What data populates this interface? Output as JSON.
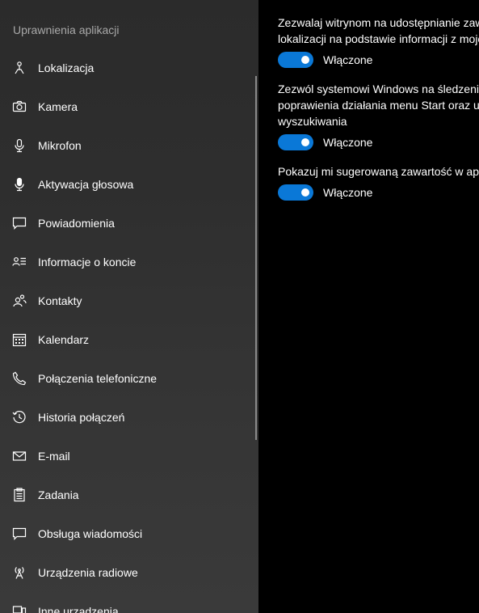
{
  "sidebar": {
    "heading": "Uprawnienia aplikacji",
    "items": [
      {
        "label": "Lokalizacja",
        "icon": "location-icon"
      },
      {
        "label": "Kamera",
        "icon": "camera-icon"
      },
      {
        "label": "Mikrofon",
        "icon": "microphone-icon"
      },
      {
        "label": "Aktywacja głosowa",
        "icon": "voice-activation-icon"
      },
      {
        "label": "Powiadomienia",
        "icon": "notifications-icon"
      },
      {
        "label": "Informacje o koncie",
        "icon": "account-info-icon"
      },
      {
        "label": "Kontakty",
        "icon": "contacts-icon"
      },
      {
        "label": "Kalendarz",
        "icon": "calendar-icon"
      },
      {
        "label": "Połączenia telefoniczne",
        "icon": "phone-icon"
      },
      {
        "label": "Historia połączeń",
        "icon": "history-icon"
      },
      {
        "label": "E-mail",
        "icon": "mail-icon"
      },
      {
        "label": "Zadania",
        "icon": "tasks-icon"
      },
      {
        "label": "Obsługa wiadomości",
        "icon": "messaging-icon"
      },
      {
        "label": "Urządzenia radiowe",
        "icon": "radio-icon"
      },
      {
        "label": "Inne urządzenia",
        "icon": "devices-icon"
      }
    ]
  },
  "settings": [
    {
      "description_lines": [
        "Zezwalaj witrynom na udostępnianie zaw",
        "lokalizacji na podstawie informacji z moje"
      ],
      "toggle_on": true,
      "toggle_label": "Włączone"
    },
    {
      "description_lines": [
        "Zezwól systemowi Windows na śledzenie",
        "poprawienia działania menu Start oraz u",
        "wyszukiwania"
      ],
      "toggle_on": true,
      "toggle_label": "Włączone"
    },
    {
      "description_lines": [
        "Pokazuj mi sugerowaną zawartość w apli"
      ],
      "toggle_on": true,
      "toggle_label": "Włączone"
    }
  ],
  "colors": {
    "accent": "#0a78d7",
    "sidebar_bg": "#2e2e2e",
    "content_bg": "#000000",
    "heading_text": "#a9a9a9"
  }
}
